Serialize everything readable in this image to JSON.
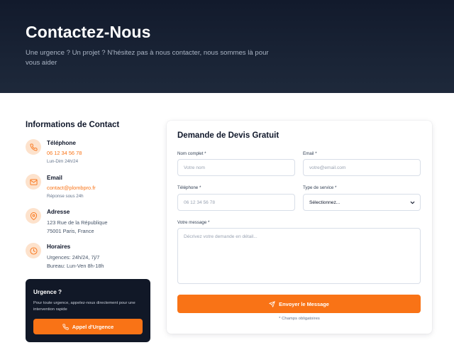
{
  "hero": {
    "title": "Contactez-Nous",
    "subtitle": "Une urgence ? Un projet ? N'hésitez pas à nous contacter, nous sommes là pour vous aider"
  },
  "contact_info": {
    "title": "Informations de Contact",
    "items": [
      {
        "icon": "phone-icon",
        "label": "Téléphone",
        "line1": "06 12 34 56 78",
        "line2": "Lun-Dim 24h/24"
      },
      {
        "icon": "mail-icon",
        "label": "Email",
        "line1": "contact@plombpro.fr",
        "line2": "Réponse sous 24h"
      },
      {
        "icon": "map-pin-icon",
        "label": "Adresse",
        "line1": "123 Rue de la République",
        "line2": "75001 Paris, France"
      },
      {
        "icon": "clock-icon",
        "label": "Horaires",
        "line1": "Urgences: 24h/24, 7j/7",
        "line2": "Bureau: Lun-Ven 8h-18h"
      }
    ]
  },
  "urgency": {
    "title": "Urgence ?",
    "text": "Pour toute urgence, appelez-nous directement pour une intervention rapide",
    "button_label": "Appel d'Urgence"
  },
  "form": {
    "title": "Demande de Devis Gratuit",
    "name_label": "Nom complet *",
    "name_placeholder": "Votre nom",
    "email_label": "Email *",
    "email_placeholder": "votre@email.com",
    "phone_label": "Téléphone *",
    "phone_placeholder": "06 12 34 56 78",
    "service_label": "Type de service *",
    "service_selected": "Sélectionnez...",
    "message_label": "Votre message *",
    "message_placeholder": "Décrivez votre demande en détail...",
    "submit_label": "Envoyer le Message",
    "required_note": "* Champs obligatoires"
  },
  "colors": {
    "accent": "#f97316",
    "hero_bg": "#1e293b",
    "icon_bg": "#fde2cc",
    "dark_card": "#111827"
  }
}
